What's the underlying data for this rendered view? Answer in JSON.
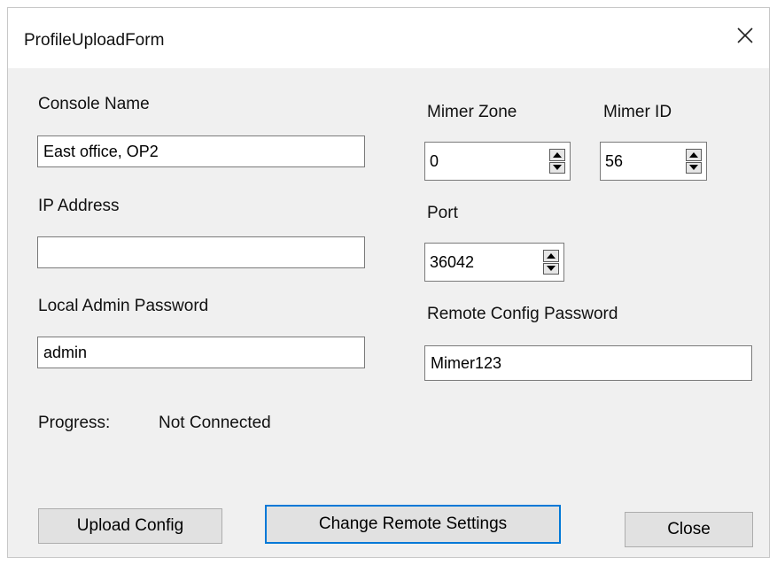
{
  "window": {
    "title": "ProfileUploadForm"
  },
  "form": {
    "console_name": {
      "label": "Console Name",
      "value": "East office, OP2"
    },
    "ip_address": {
      "label": "IP Address",
      "value": ""
    },
    "local_admin_password": {
      "label": "Local Admin Password",
      "value": "admin"
    },
    "mimer_zone": {
      "label": "Mimer Zone",
      "value": "0"
    },
    "mimer_id": {
      "label": "Mimer ID",
      "value": "56"
    },
    "port": {
      "label": "Port",
      "value": "36042"
    },
    "remote_config_password": {
      "label": "Remote Config Password",
      "value": "Mimer123"
    },
    "progress": {
      "label": "Progress:",
      "value": "Not Connected"
    }
  },
  "buttons": {
    "upload": "Upload Config",
    "change_remote": "Change Remote Settings",
    "close": "Close"
  },
  "icons": {
    "close": "close-icon",
    "spin_up": "triangle-up-icon",
    "spin_down": "triangle-down-icon"
  },
  "colors": {
    "window_bg": "#f0f0f0",
    "titlebar_bg": "#ffffff",
    "default_button_border": "#0078d7"
  }
}
